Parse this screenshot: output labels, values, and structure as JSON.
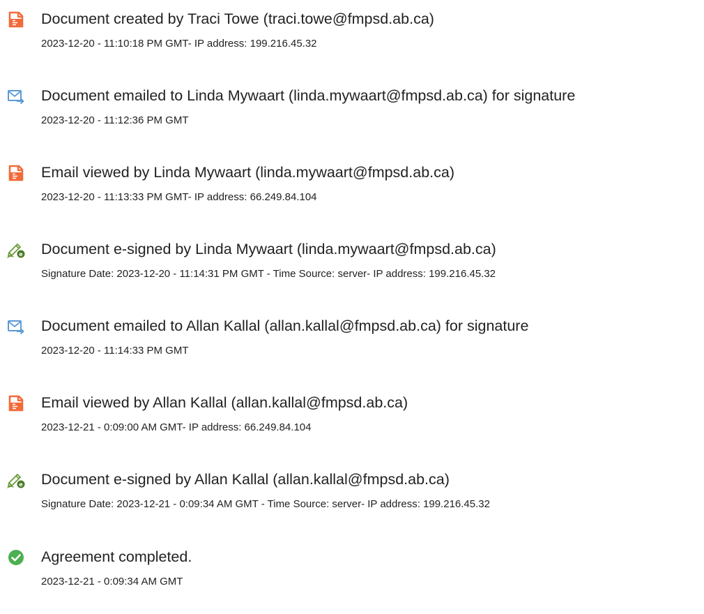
{
  "events": [
    {
      "icon": "document-created-icon",
      "title": "Document created by Traci Towe (traci.towe@fmpsd.ab.ca)",
      "detail": "2023-12-20 - 11:10:18 PM GMT- IP address: 199.216.45.32"
    },
    {
      "icon": "email-sent-icon",
      "title": "Document emailed to Linda Mywaart (linda.mywaart@fmpsd.ab.ca) for signature",
      "detail": "2023-12-20 - 11:12:36 PM GMT"
    },
    {
      "icon": "email-viewed-icon",
      "title": "Email viewed by Linda Mywaart (linda.mywaart@fmpsd.ab.ca)",
      "detail": "2023-12-20 - 11:13:33 PM GMT- IP address: 66.249.84.104"
    },
    {
      "icon": "e-sign-pen-icon",
      "title": "Document e-signed by Linda Mywaart (linda.mywaart@fmpsd.ab.ca)",
      "detail": "Signature Date: 2023-12-20 - 11:14:31 PM GMT - Time Source: server- IP address: 199.216.45.32"
    },
    {
      "icon": "email-sent-icon",
      "title": "Document emailed to Allan Kallal (allan.kallal@fmpsd.ab.ca) for signature",
      "detail": "2023-12-20 - 11:14:33 PM GMT"
    },
    {
      "icon": "email-viewed-icon",
      "title": "Email viewed by Allan Kallal (allan.kallal@fmpsd.ab.ca)",
      "detail": "2023-12-21 - 0:09:00 AM GMT- IP address: 66.249.84.104"
    },
    {
      "icon": "e-sign-pen-icon",
      "title": "Document e-signed by Allan Kallal (allan.kallal@fmpsd.ab.ca)",
      "detail": "Signature Date: 2023-12-21 - 0:09:34 AM GMT - Time Source: server- IP address: 199.216.45.32"
    },
    {
      "icon": "completed-check-icon",
      "title": "Agreement completed.",
      "detail": "2023-12-21 - 0:09:34 AM GMT"
    }
  ],
  "colors": {
    "document_icon": "#f26b3a",
    "email_icon": "#5b9bd5",
    "pen_icon": "#6a9a3a",
    "check_icon": "#4caf50",
    "text": "#222222"
  }
}
